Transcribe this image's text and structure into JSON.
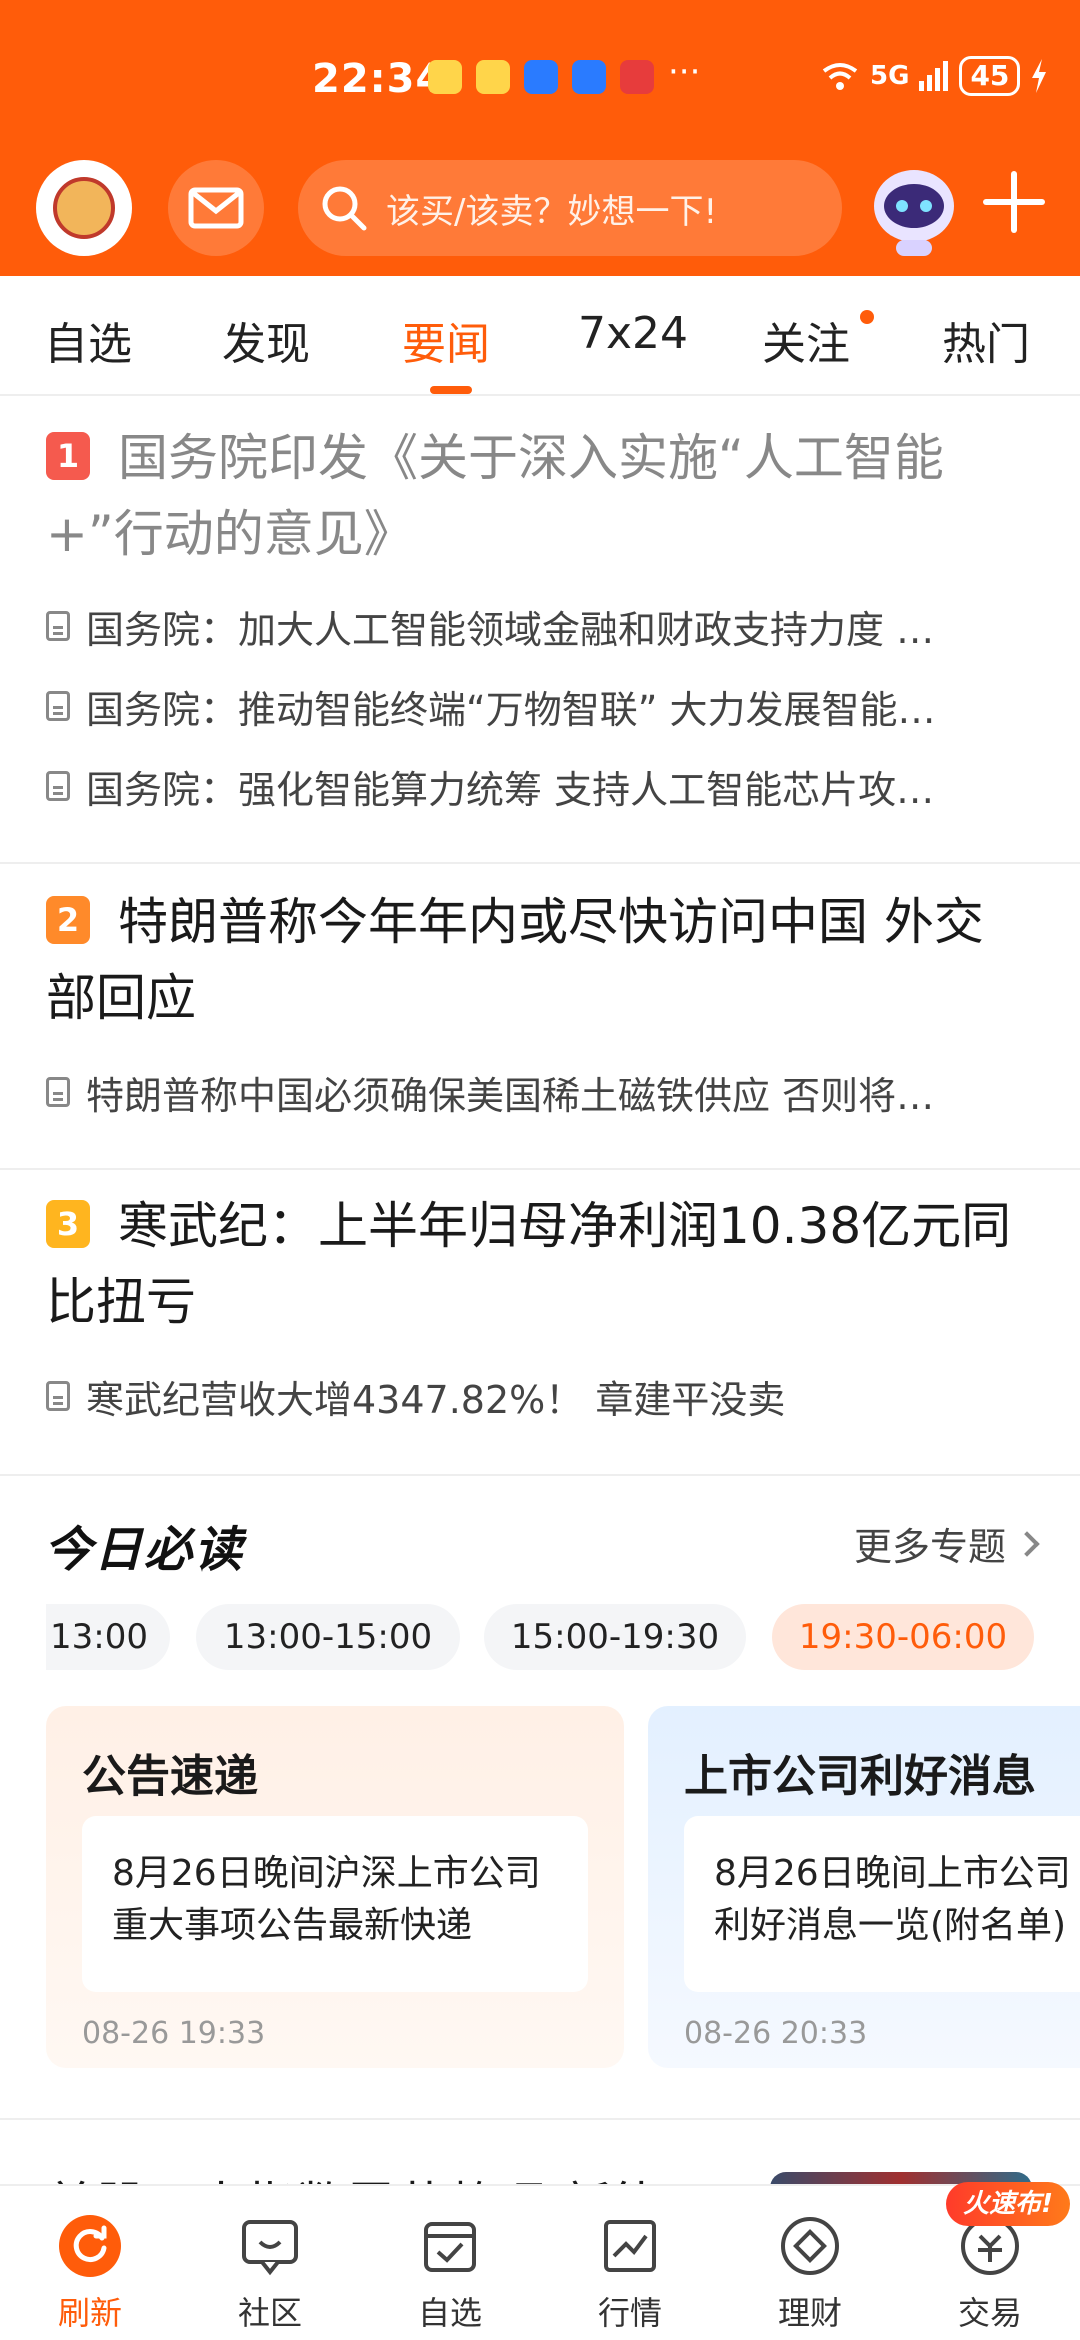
{
  "status_bar": {
    "time": "22:34",
    "signal": "5G",
    "battery": "45"
  },
  "header": {
    "search_placeholder": "该买/该卖？妙想一下!"
  },
  "tabs": [
    {
      "label": "自选"
    },
    {
      "label": "发现"
    },
    {
      "label": "要闻"
    },
    {
      "label": "7x24"
    },
    {
      "label": "关注"
    },
    {
      "label": "热门"
    }
  ],
  "active_tab": "要闻",
  "news": [
    {
      "rank": "1",
      "title": "国务院印发《关于深入实施“人工智能+”行动的意见》",
      "subs": [
        "国务院：加大人工智能领域金融和财政支持力度 …",
        "国务院：推动智能终端“万物智联” 大力发展智能…",
        "国务院：强化智能算力统筹 支持人工智能芯片攻…"
      ]
    },
    {
      "rank": "2",
      "title": "特朗普称今年年内或尽快访问中国 外交部回应",
      "subs": [
        "特朗普称中国必须确保美国稀土磁铁供应 否则将…"
      ]
    },
    {
      "rank": "3",
      "title": "寒武纪：上半年归母净利润10.38亿元同比扭亏",
      "subs": [
        "寒武纪营收大增4347.82%！ 章建平没卖"
      ]
    }
  ],
  "today": {
    "title": "今日必读",
    "more": "更多专题",
    "chips": [
      "13:00",
      "13:00-15:00",
      "15:00-19:30",
      "19:30-06:00"
    ],
    "cards": [
      {
        "title": "公告速递",
        "body": "8月26日晚间沪深上市公司重大事项公告最新快递",
        "time": "08-26 19:33"
      },
      {
        "title": "上市公司利好消息",
        "body": "8月26日晚间上市公司利好消息一览(附名单)",
        "time": "08-26 20:33"
      }
    ]
  },
  "next_title": "美股三大指数震荡整理 新能",
  "bottom_nav": [
    {
      "label": "刷新"
    },
    {
      "label": "社区"
    },
    {
      "label": "自选"
    },
    {
      "label": "行情"
    },
    {
      "label": "理财"
    },
    {
      "label": "交易"
    }
  ],
  "badge": "火速布!",
  "colors": {
    "brand": "#ff5c0a",
    "rank1": "#f55a4e",
    "rank2": "#ff8a2a",
    "rank3": "#ffb51f"
  }
}
